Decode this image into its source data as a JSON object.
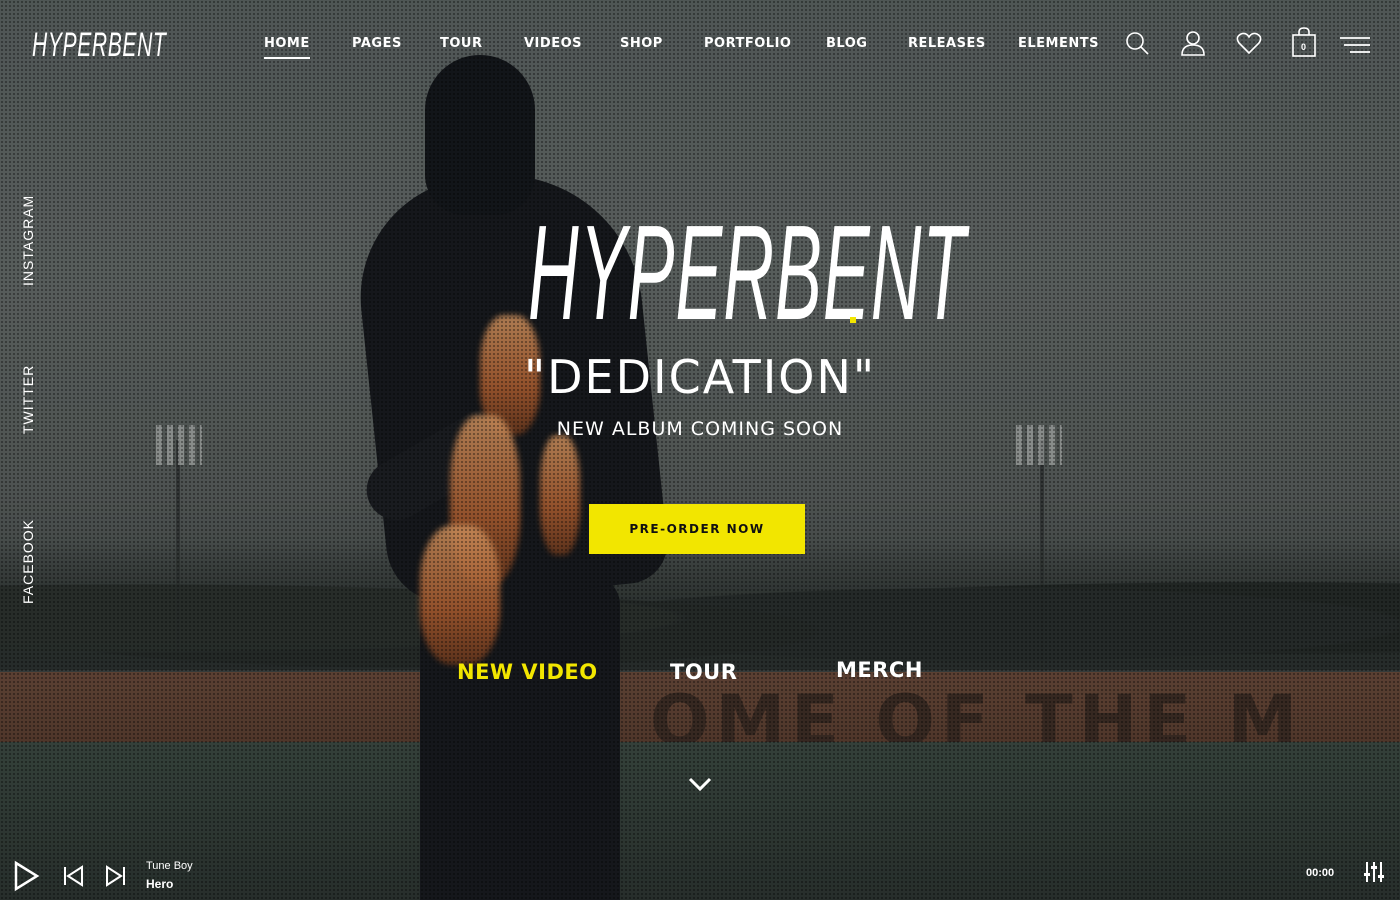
{
  "brand": {
    "logo_text": "HYPERBENT",
    "accent_color": "#f2e600"
  },
  "nav": {
    "items": [
      "HOME",
      "PAGES",
      "TOUR",
      "VIDEOS",
      "SHOP",
      "PORTFOLIO",
      "BLOG",
      "RELEASES",
      "ELEMENTS"
    ],
    "active": "HOME"
  },
  "header_icons": [
    "search-icon",
    "user-icon",
    "heart-icon",
    "shopping-bag-icon",
    "menu-icon"
  ],
  "cart": {
    "count": "0"
  },
  "social": [
    "INSTAGRAM",
    "TWITTER",
    "FACEBOOK"
  ],
  "hero": {
    "title": "HYPERBENT",
    "subtitle": "\"DEDICATION\"",
    "tagline": "NEW ALBUM COMING SOON",
    "cta_label": "PRE-ORDER NOW"
  },
  "quick_links": [
    "NEW VIDEO",
    "TOUR",
    "MERCH"
  ],
  "background": {
    "wall_text": "OME OF THE M"
  },
  "player": {
    "artist": "Tune Boy",
    "track": "Hero",
    "time": "00:00"
  }
}
